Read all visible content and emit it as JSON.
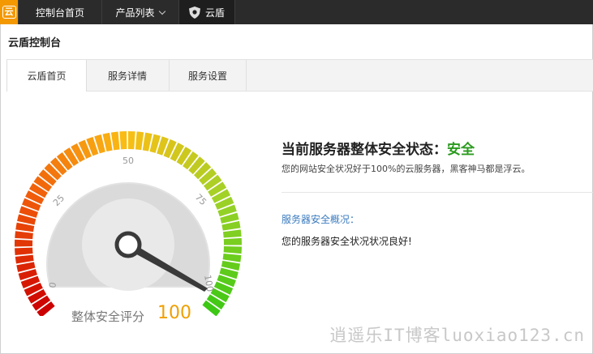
{
  "topbar": {
    "logo_char": "云",
    "home_label": "控制台首页",
    "products_label": "产品列表",
    "shield_label": "云盾"
  },
  "page_title": "云盾控制台",
  "tabs": [
    {
      "label": "云盾首页",
      "active": true
    },
    {
      "label": "服务详情",
      "active": false
    },
    {
      "label": "服务设置",
      "active": false
    }
  ],
  "gauge": {
    "ticks": [
      "0",
      "25",
      "50",
      "75",
      "100"
    ],
    "score_label": "整体安全评分",
    "score": 100
  },
  "status": {
    "title": "当前服务器整体安全状态：",
    "value": "安全",
    "desc": "您的网站安全状况好于100%的云服务器，黑客神马都是浮云。"
  },
  "overview": {
    "title": "服务器安全概况：",
    "text": "您的服务器安全状况状况良好!"
  },
  "watermark": "逍遥乐IT博客luoxiao123.cn"
}
